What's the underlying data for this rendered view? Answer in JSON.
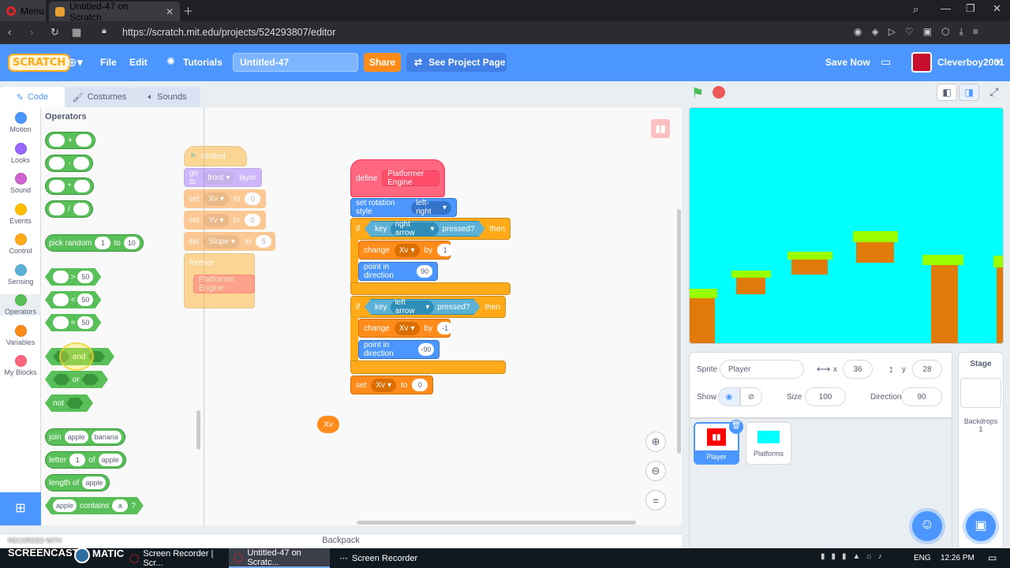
{
  "browser": {
    "menu_label": "Menu",
    "tab_title": "Untitled-47 on Scratch",
    "url": "https://scratch.mit.edu/projects/524293807/editor"
  },
  "menubar": {
    "logo": "SCRATCH",
    "file": "File",
    "edit": "Edit",
    "tutorials": "Tutorials",
    "project_title": "Untitled-47",
    "share": "Share",
    "see_project": "See Project Page",
    "save_now": "Save Now",
    "username": "Cleverboy2001"
  },
  "tabs": {
    "code": "Code",
    "costumes": "Costumes",
    "sounds": "Sounds"
  },
  "categories": [
    {
      "label": "Motion",
      "color": "#4c97ff"
    },
    {
      "label": "Looks",
      "color": "#9966ff"
    },
    {
      "label": "Sound",
      "color": "#cf63cf"
    },
    {
      "label": "Events",
      "color": "#ffbf00"
    },
    {
      "label": "Control",
      "color": "#ffab19"
    },
    {
      "label": "Sensing",
      "color": "#5cb1d6"
    },
    {
      "label": "Operators",
      "color": "#59c059"
    },
    {
      "label": "Variables",
      "color": "#ff8c1a"
    },
    {
      "label": "My Blocks",
      "color": "#ff6680"
    }
  ],
  "palette": {
    "heading": "Operators",
    "plus": "+",
    "minus": "-",
    "times": "*",
    "divide": "/",
    "pick_random": "pick random",
    "pr_from": "1",
    "pr_to_label": "to",
    "pr_to": "10",
    "gt": ">",
    "lt": "<",
    "eq": "=",
    "cmp_val": "50",
    "and": "and",
    "or": "or",
    "not": "not",
    "join": "join",
    "join_a": "apple",
    "join_b": "banana",
    "letter": "letter",
    "letter_n": "1",
    "of": "of",
    "letter_s": "apple",
    "length_of": "length of",
    "length_s": "apple",
    "contains_s": "apple",
    "contains": "contains",
    "contains_c": "a",
    "q": "?"
  },
  "script_left": {
    "clicked": "clicked",
    "go_to": "go to",
    "front": "front",
    "layer": "layer",
    "set": "set",
    "xv": "Xv",
    "to": "to",
    "zero": "0",
    "yv": "Yv",
    "slope": "Slope",
    "five": "5",
    "forever": "forever",
    "platformer": "Platformer Engine"
  },
  "script_main": {
    "define": "define",
    "proc_name": "Platformer Engine",
    "set_rot": "set rotation style",
    "rot_val": "left-right",
    "if": "if",
    "key": "key",
    "right_arrow": "right arrow",
    "pressed": "pressed?",
    "then": "then",
    "change": "change",
    "var": "Xv",
    "by": "by",
    "one": "1",
    "point_dir": "point in direction",
    "ninety": "90",
    "left_arrow": "left arrow",
    "neg_one": "-1",
    "neg_ninety": "-90",
    "set": "set",
    "to": "to",
    "zero": "0"
  },
  "reporter_xv": "Xv",
  "backpack": "Backpack",
  "sprite_info": {
    "sprite_label": "Sprite",
    "sprite_name": "Player",
    "x_label": "x",
    "x": "36",
    "y_label": "y",
    "y": "28",
    "show_label": "Show",
    "size_label": "Size",
    "size": "100",
    "direction_label": "Direction",
    "direction": "90"
  },
  "sprites": [
    {
      "name": "Player"
    },
    {
      "name": "Platforms"
    }
  ],
  "stage_panel": {
    "label": "Stage",
    "backdrops_label": "Backdrops",
    "backdrops": "1"
  },
  "taskbar": {
    "recorded_with": "RECORDED WITH",
    "screencast": "SCREENCAST",
    "matic": "MATIC",
    "task1": "Screen Recorder | Scr...",
    "task2": "Untitled-47 on Scratc...",
    "task3": "Screen Recorder",
    "lang": "ENG",
    "time": "12:26 PM"
  }
}
